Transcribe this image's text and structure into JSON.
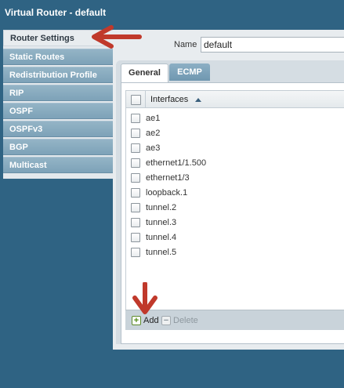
{
  "window": {
    "title": "Virtual Router - default"
  },
  "sidebar": {
    "items": [
      {
        "label": "Router Settings",
        "active": true
      },
      {
        "label": "Static Routes"
      },
      {
        "label": "Redistribution Profile"
      },
      {
        "label": "RIP"
      },
      {
        "label": "OSPF"
      },
      {
        "label": "OSPFv3"
      },
      {
        "label": "BGP"
      },
      {
        "label": "Multicast"
      }
    ]
  },
  "form": {
    "name_label": "Name",
    "name_value": "default"
  },
  "tabs": [
    {
      "label": "General",
      "active": true
    },
    {
      "label": "ECMP"
    }
  ],
  "interfaces": {
    "header": "Interfaces",
    "rows": [
      "ae1",
      "ae2",
      "ae3",
      "ethernet1/1.500",
      "ethernet1/3",
      "loopback.1",
      "tunnel.2",
      "tunnel.3",
      "tunnel.4",
      "tunnel.5"
    ]
  },
  "toolbar": {
    "add_label": "Add",
    "delete_label": "Delete"
  },
  "colors": {
    "accent": "#2f6383",
    "annotation_arrow": "#c0392b"
  }
}
